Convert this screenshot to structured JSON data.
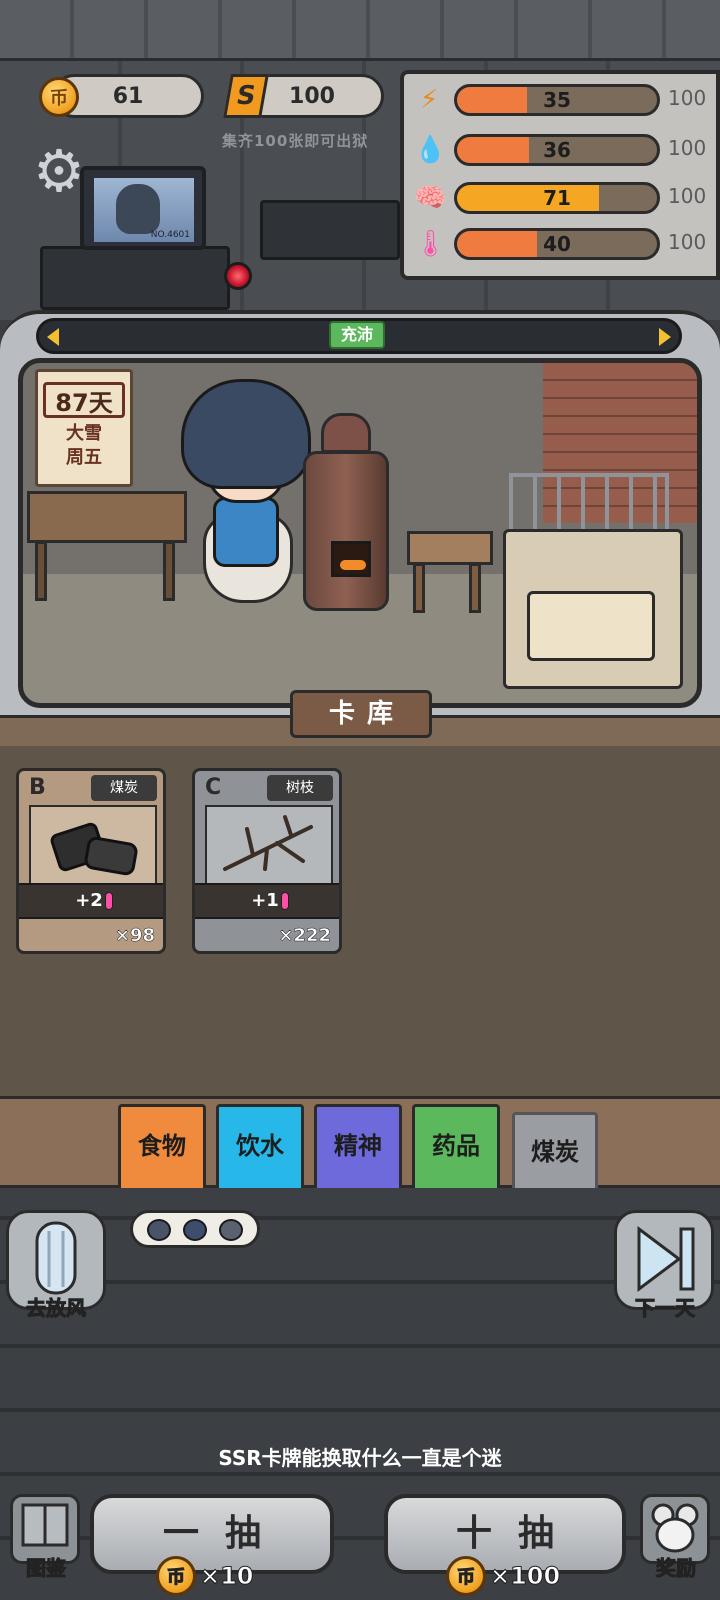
{
  "hud": {
    "coins": "61",
    "coin_symbol": "币",
    "shards_symbol": "S",
    "shards": "100",
    "hint": "集齐100张即可出狱"
  },
  "monitor": {
    "label": "NO.4601"
  },
  "stats": [
    {
      "name": "energy",
      "icon": "lightning-icon",
      "glyph": "⚡",
      "value": "35",
      "max": "100",
      "level": 0.35,
      "color": "#f07b3f"
    },
    {
      "name": "water",
      "icon": "water-drop-icon",
      "glyph": "💧",
      "value": "36",
      "max": "100",
      "level": 0.36,
      "color": "#f07b3f"
    },
    {
      "name": "mind",
      "icon": "brain-icon",
      "glyph": "🧠",
      "value": "71",
      "max": "100",
      "level": 0.71,
      "color": "#f5a623"
    },
    {
      "name": "temperature",
      "icon": "thermometer-icon",
      "glyph": "🌡",
      "value": "40",
      "max": "100",
      "level": 0.4,
      "color": "#f07b3f"
    }
  ],
  "mood": {
    "label": "充沛"
  },
  "day_sign": {
    "days": "87天",
    "weather": "大雪",
    "weekday": "周五"
  },
  "deck": {
    "title": "卡库"
  },
  "cards": [
    {
      "grade": "B",
      "name": "煤炭",
      "effect": "+2",
      "count": "×98",
      "bg": "#b49a80",
      "art_bg": "#cdb9a2"
    },
    {
      "grade": "C",
      "name": "树枝",
      "effect": "+1",
      "count": "×222",
      "bg": "#8f9296",
      "art_bg": "#b5b8bb"
    }
  ],
  "tabs": [
    {
      "label": "食物",
      "color": "#f08a3c"
    },
    {
      "label": "饮水",
      "color": "#27b7e8"
    },
    {
      "label": "精神",
      "color": "#6f6adc"
    },
    {
      "label": "药品",
      "color": "#5cb85c"
    },
    {
      "label": "煤炭",
      "color": "#9a9da1"
    }
  ],
  "actions": {
    "go_out": "去放风",
    "next_day": "下一天",
    "tip": "SSR卡牌能换取什么一直是个迷",
    "single_draw": "一抽",
    "single_cost": "×10",
    "ten_draw": "十抽",
    "ten_cost": "×100",
    "catalog": "图鉴",
    "rewards": "奖励"
  }
}
